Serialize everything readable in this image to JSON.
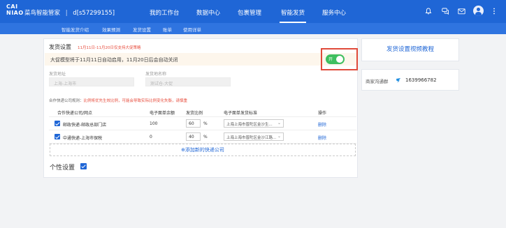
{
  "colors": {
    "brand": "#1f66d6",
    "toggle_on": "#3fbf5f",
    "highlight": "#e04a3a",
    "warning_text": "#e74c3c"
  },
  "logo": {
    "line1": "CAI",
    "line2": "NIAO"
  },
  "header": {
    "brand_name": "菜鸟智能管家",
    "separator": "|",
    "account": "d[s57299155]"
  },
  "nav": {
    "items": [
      "我的工作台",
      "数据中心",
      "包裹管理",
      "智能发货",
      "服务中心"
    ],
    "active": "智能发货"
  },
  "top_icons": [
    "bell-icon",
    "chat-icon",
    "mail-icon",
    "user-avatar",
    "more-vert-icon"
  ],
  "subnav": {
    "items": [
      "智能发货介绍",
      "效果预测",
      "发货设置",
      "账单",
      "使用详单"
    ]
  },
  "shipping": {
    "title": "发货设置",
    "note": "11月11日-11月20日仅支持大促策略",
    "notice": "大促模型将于11月11日自动启用，11月20日后会自动关闭",
    "toggle_label": "开",
    "toggle_on": true,
    "address_label": "发货地址",
    "address_placeholder": "上海-上海市",
    "warehouse_label": "发货地名称",
    "warehouse_placeholder": "测试仓-大促",
    "tip_prefix": "合作快递公司规则：",
    "tip_red": "比例将优先生效比例，可能会导致实际比例变化失衡，请慎重",
    "columns": [
      "合作快递公司/网点",
      "电子面单余额",
      "发货比例",
      "电子面单发货标准",
      "操作"
    ],
    "rows": [
      {
        "company": "邮政快递-邮政总部门店",
        "balance": "100",
        "ratio": "60",
        "unit": "%",
        "standard": "上海上海市普陀区金沙生...",
        "action": "删除"
      },
      {
        "company": "中通快递-上海市保税",
        "balance": "0",
        "ratio": "40",
        "unit": "%",
        "standard": "上海上海市普陀区金沙江路...",
        "action": "删除"
      }
    ],
    "add_company": "⊕添加新的快递公司",
    "personal_label": "个性设置"
  },
  "side": {
    "video_link": "发货设置视频教程",
    "contact_label": "商家沟通群",
    "contact_number": "1639966782"
  }
}
